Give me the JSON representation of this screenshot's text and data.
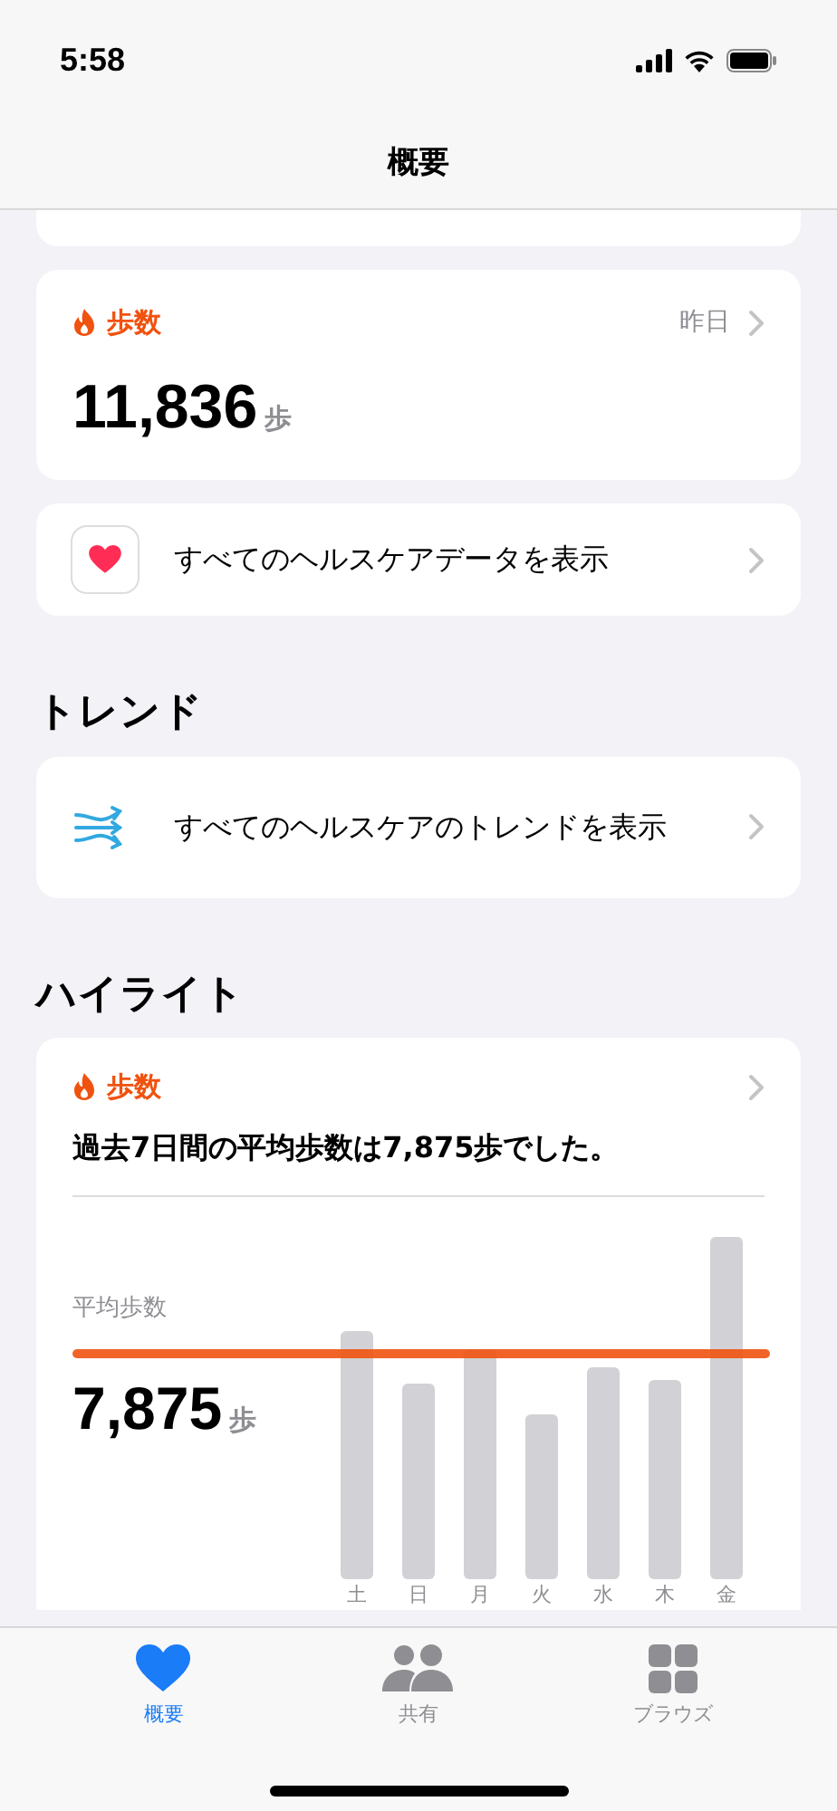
{
  "status_bar": {
    "time": "5:58"
  },
  "nav": {
    "title": "概要"
  },
  "steps_card": {
    "title": "歩数",
    "date": "昨日",
    "value": "11,836",
    "unit": "歩"
  },
  "all_data": {
    "label": "すべてのヘルスケアデータを表示"
  },
  "trends": {
    "heading": "トレンド",
    "label": "すべてのヘルスケアのトレンドを表示"
  },
  "highlights": {
    "heading": "ハイライト",
    "title": "歩数",
    "summary": "過去7日間の平均歩数は7,875歩でした。",
    "avg_label": "平均歩数",
    "avg_value": "7,875",
    "avg_unit": "歩",
    "days": [
      "土",
      "日",
      "月",
      "火",
      "水",
      "木",
      "金"
    ]
  },
  "tab_bar": [
    {
      "label": "概要",
      "selected": true,
      "kind": "heart"
    },
    {
      "label": "共有",
      "selected": false,
      "kind": "people"
    },
    {
      "label": "ブラウズ",
      "selected": false,
      "kind": "grid"
    }
  ]
}
